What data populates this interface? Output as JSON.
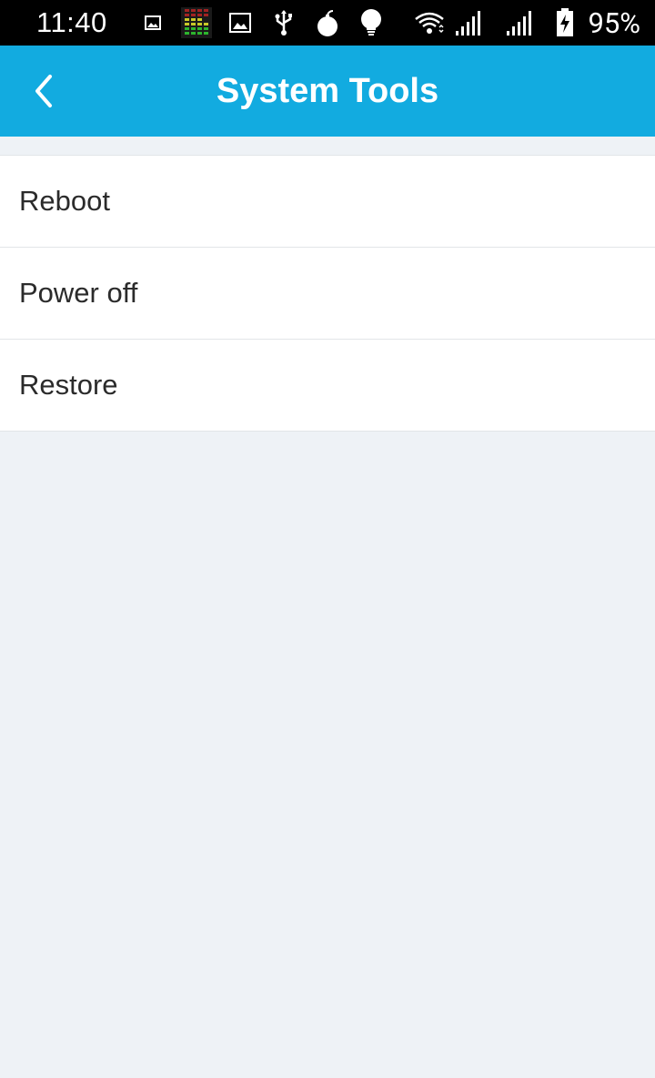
{
  "status_bar": {
    "time": "11:40",
    "battery_percent": "95%",
    "icons": [
      "image-icon",
      "equalizer-app-icon",
      "gallery-icon",
      "usb-icon",
      "bomb-icon",
      "lightbulb-icon",
      "wifi-icon",
      "signal-icon",
      "signal-icon",
      "battery-charging-icon"
    ]
  },
  "header": {
    "title": "System Tools",
    "back_icon": "chevron-left-icon"
  },
  "menu": {
    "items": [
      {
        "label": "Reboot"
      },
      {
        "label": "Power off"
      },
      {
        "label": "Restore"
      }
    ]
  },
  "colors": {
    "app_bar": "#12abe0",
    "background": "#eef2f6"
  }
}
